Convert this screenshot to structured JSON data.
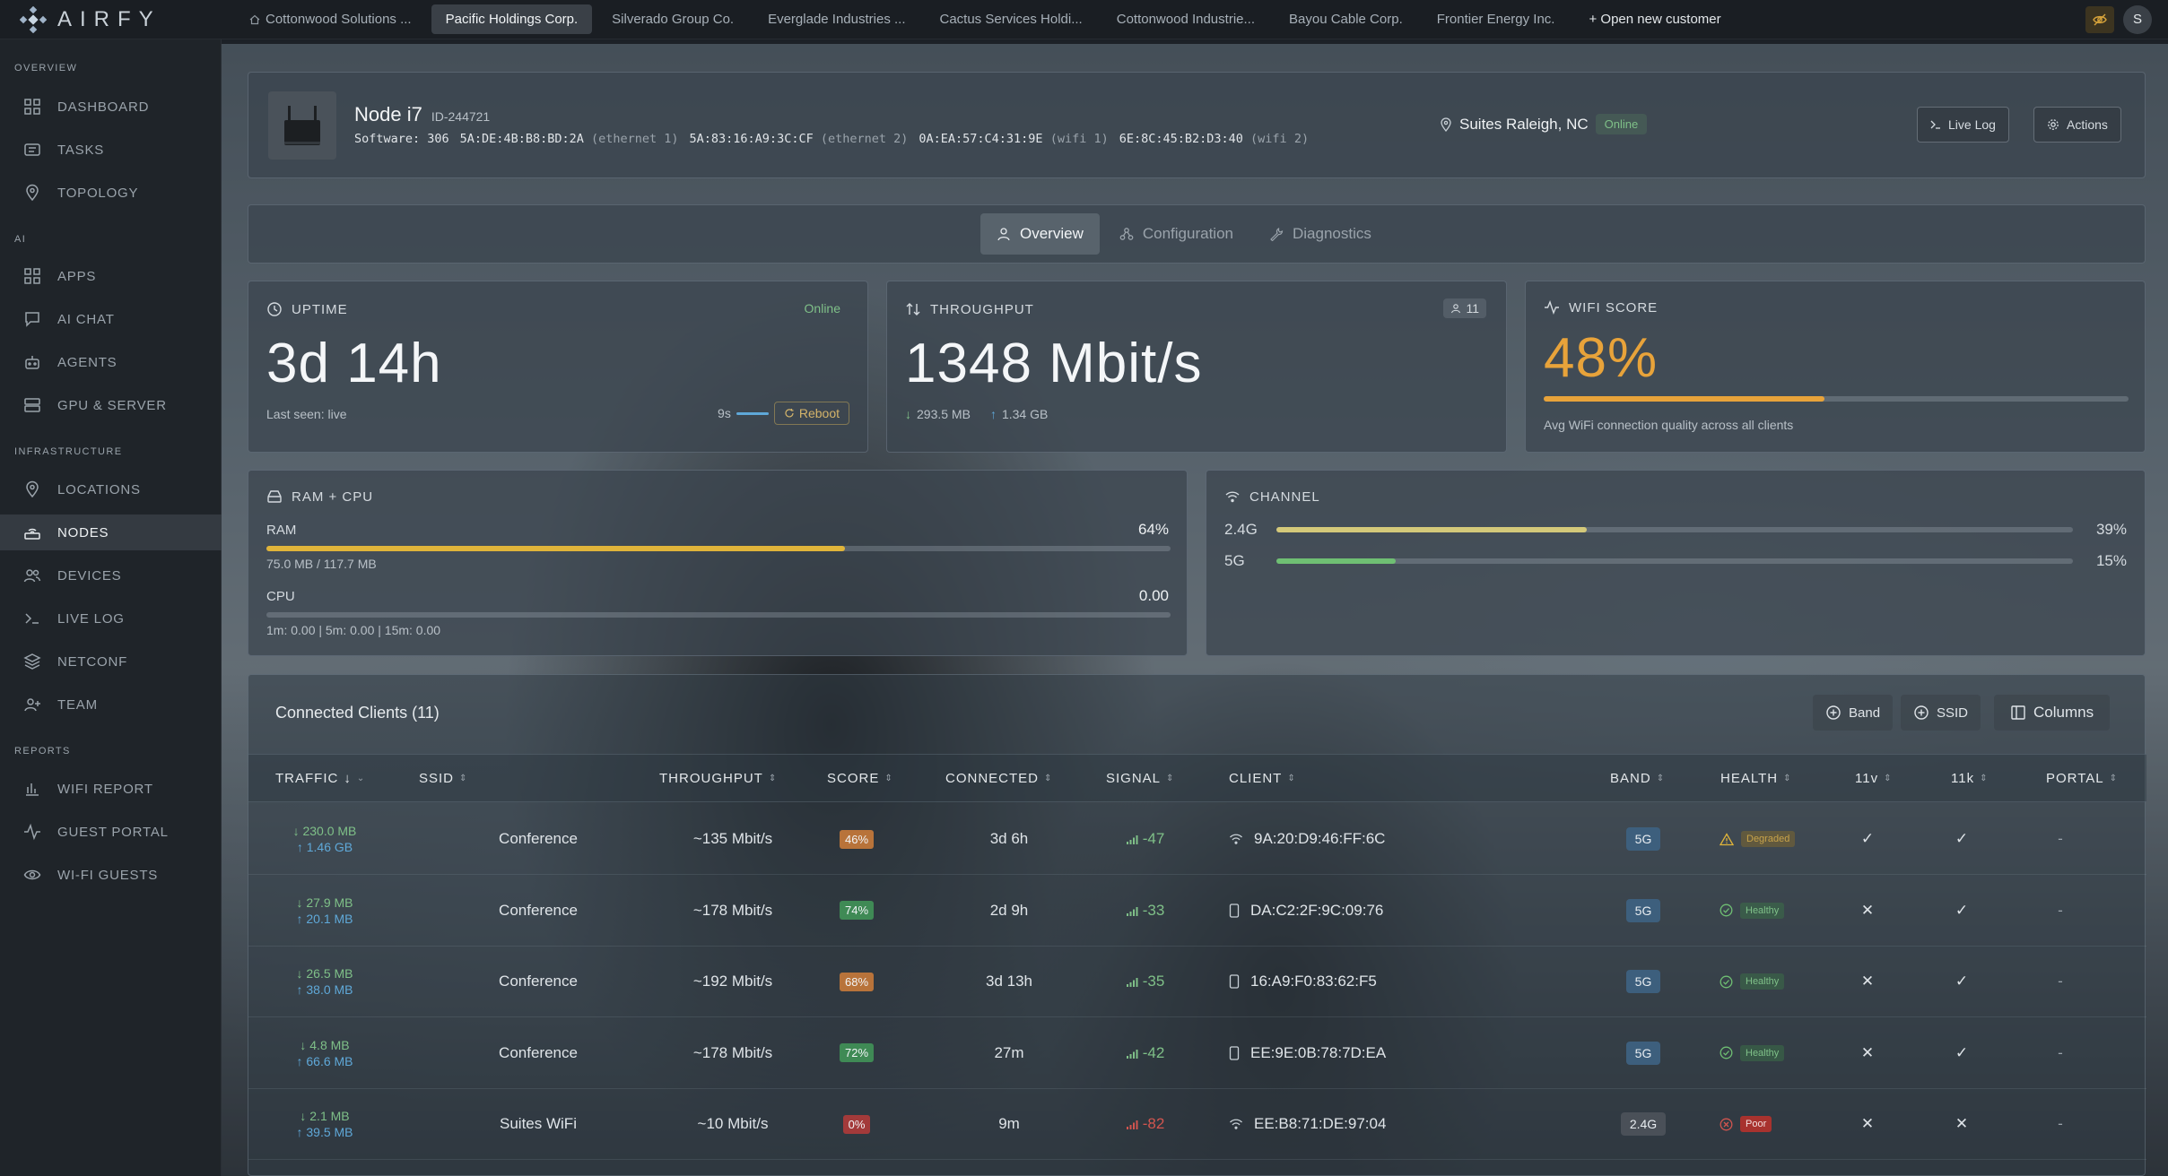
{
  "app": {
    "brand": "AIRFY"
  },
  "topbar": {
    "tabs": [
      "Cottonwood Solutions ...",
      "Pacific Holdings Corp.",
      "Silverado Group Co.",
      "Everglade Industries ...",
      "Cactus Services Holdi...",
      "Cottonwood Industrie...",
      "Bayou Cable Corp.",
      "Frontier Energy Inc."
    ],
    "open_new": "+ Open new customer",
    "avatar_initial": "S"
  },
  "sidebar": {
    "sections": {
      "overview": "OVERVIEW",
      "ai": "AI",
      "infrastructure": "INFRASTRUCTURE",
      "reports": "REPORTS"
    },
    "items": {
      "dashboard": "DASHBOARD",
      "tasks": "TASKS",
      "topology": "TOPOLOGY",
      "apps": "APPS",
      "ai_chat": "AI CHAT",
      "agents": "AGENTS",
      "gpu_server": "GPU & SERVER",
      "locations": "LOCATIONS",
      "nodes": "NODES",
      "devices": "DEVICES",
      "live_log": "LIVE LOG",
      "netconf": "NETCONF",
      "team": "TEAM",
      "wifi_report": "WIFI REPORT",
      "guest_portal": "GUEST PORTAL",
      "wifi_guests": "WI-FI GUESTS"
    }
  },
  "node": {
    "name": "Node i7",
    "id": "ID-244721",
    "software_label": "Software: 306",
    "macs": [
      {
        "mac": "5A:DE:4B:B8:BD:2A",
        "iface": "(ethernet 1)"
      },
      {
        "mac": "5A:83:16:A9:3C:CF",
        "iface": "(ethernet 2)"
      },
      {
        "mac": "0A:EA:57:C4:31:9E",
        "iface": "(wifi 1)"
      },
      {
        "mac": "6E:8C:45:B2:D3:40",
        "iface": "(wifi 2)"
      }
    ],
    "location": "Suites Raleigh, NC",
    "status": "Online",
    "live_log_btn": "Live Log",
    "actions_btn": "Actions"
  },
  "view_tabs": {
    "overview": "Overview",
    "configuration": "Configuration",
    "diagnostics": "Diagnostics"
  },
  "uptime": {
    "label": "UPTIME",
    "status": "Online",
    "value": "3d 14h",
    "last_seen": "Last seen: live",
    "interval": "9s",
    "reboot": "Reboot"
  },
  "throughput": {
    "label": "THROUGHPUT",
    "value": "1348 Mbit/s",
    "clients": "11",
    "down": "293.5 MB",
    "up": "1.34 GB"
  },
  "wifi_score": {
    "label": "WIFI SCORE",
    "value": "48%",
    "fraction": 0.48,
    "caption": "Avg WiFi connection quality across all clients",
    "color": "#e8a33a"
  },
  "ram_cpu": {
    "label": "RAM + CPU",
    "ram_label": "RAM",
    "ram_pct": "64%",
    "ram_fraction": 0.64,
    "ram_detail": "75.0 MB / 117.7 MB",
    "cpu_label": "CPU",
    "cpu_value": "0.00",
    "cpu_detail": "1m: 0.00 | 5m: 0.00 | 15m: 0.00"
  },
  "channel": {
    "label": "CHANNEL",
    "bands": [
      {
        "name": "2.4G",
        "pct": "39%",
        "fraction": 0.39,
        "color": "#d4c97a"
      },
      {
        "name": "5G",
        "pct": "15%",
        "fraction": 0.15,
        "color": "#6fbf73"
      }
    ]
  },
  "clients": {
    "title": "Connected Clients (11)",
    "btn_band": "Band",
    "btn_ssid": "SSID",
    "btn_columns": "Columns",
    "columns": {
      "traffic": "TRAFFIC",
      "ssid": "SSID",
      "throughput": "THROUGHPUT",
      "score": "SCORE",
      "connected": "CONNECTED",
      "signal": "SIGNAL",
      "client": "CLIENT",
      "band": "BAND",
      "health": "HEALTH",
      "v11": "11v",
      "k11": "11k",
      "portal": "PORTAL"
    },
    "rows": [
      {
        "down": "230.0 MB",
        "up": "1.46 GB",
        "ssid": "Conference",
        "throughput": "~135 Mbit/s",
        "score": "46%",
        "score_color": "#b8733a",
        "connected": "3d 6h",
        "signal": "-47",
        "signal_color": "#7fc088",
        "device": "wifi",
        "client": "9A:20:D9:46:FF:6C",
        "band": "5G",
        "health": "Degraded",
        "health_kind": "warn",
        "v11": "✓",
        "k11": "✓",
        "portal": "-"
      },
      {
        "down": "27.9 MB",
        "up": "20.1 MB",
        "ssid": "Conference",
        "throughput": "~178 Mbit/s",
        "score": "74%",
        "score_color": "#3f8a55",
        "connected": "2d 9h",
        "signal": "-33",
        "signal_color": "#7fc088",
        "device": "phone",
        "client": "DA:C2:2F:9C:09:76",
        "band": "5G",
        "health": "Healthy",
        "health_kind": "ok",
        "v11": "✕",
        "k11": "✓",
        "portal": "-"
      },
      {
        "down": "26.5 MB",
        "up": "38.0 MB",
        "ssid": "Conference",
        "throughput": "~192 Mbit/s",
        "score": "68%",
        "score_color": "#b8733a",
        "connected": "3d 13h",
        "signal": "-35",
        "signal_color": "#7fc088",
        "device": "phone",
        "client": "16:A9:F0:83:62:F5",
        "band": "5G",
        "health": "Healthy",
        "health_kind": "ok",
        "v11": "✕",
        "k11": "✓",
        "portal": "-"
      },
      {
        "down": "4.8 MB",
        "up": "66.6 MB",
        "ssid": "Conference",
        "throughput": "~178 Mbit/s",
        "score": "72%",
        "score_color": "#3f8a55",
        "connected": "27m",
        "signal": "-42",
        "signal_color": "#7fc088",
        "device": "phone",
        "client": "EE:9E:0B:78:7D:EA",
        "band": "5G",
        "health": "Healthy",
        "health_kind": "ok",
        "v11": "✕",
        "k11": "✓",
        "portal": "-"
      },
      {
        "down": "2.1 MB",
        "up": "39.5 MB",
        "ssid": "Suites WiFi",
        "throughput": "~10 Mbit/s",
        "score": "0%",
        "score_color": "#a33a3a",
        "connected": "9m",
        "signal": "-82",
        "signal_color": "#d2554f",
        "device": "wifi",
        "client": "EE:B8:71:DE:97:04",
        "band": "2.4G",
        "health": "Poor",
        "health_kind": "bad",
        "v11": "✕",
        "k11": "✕",
        "portal": "-"
      }
    ]
  }
}
